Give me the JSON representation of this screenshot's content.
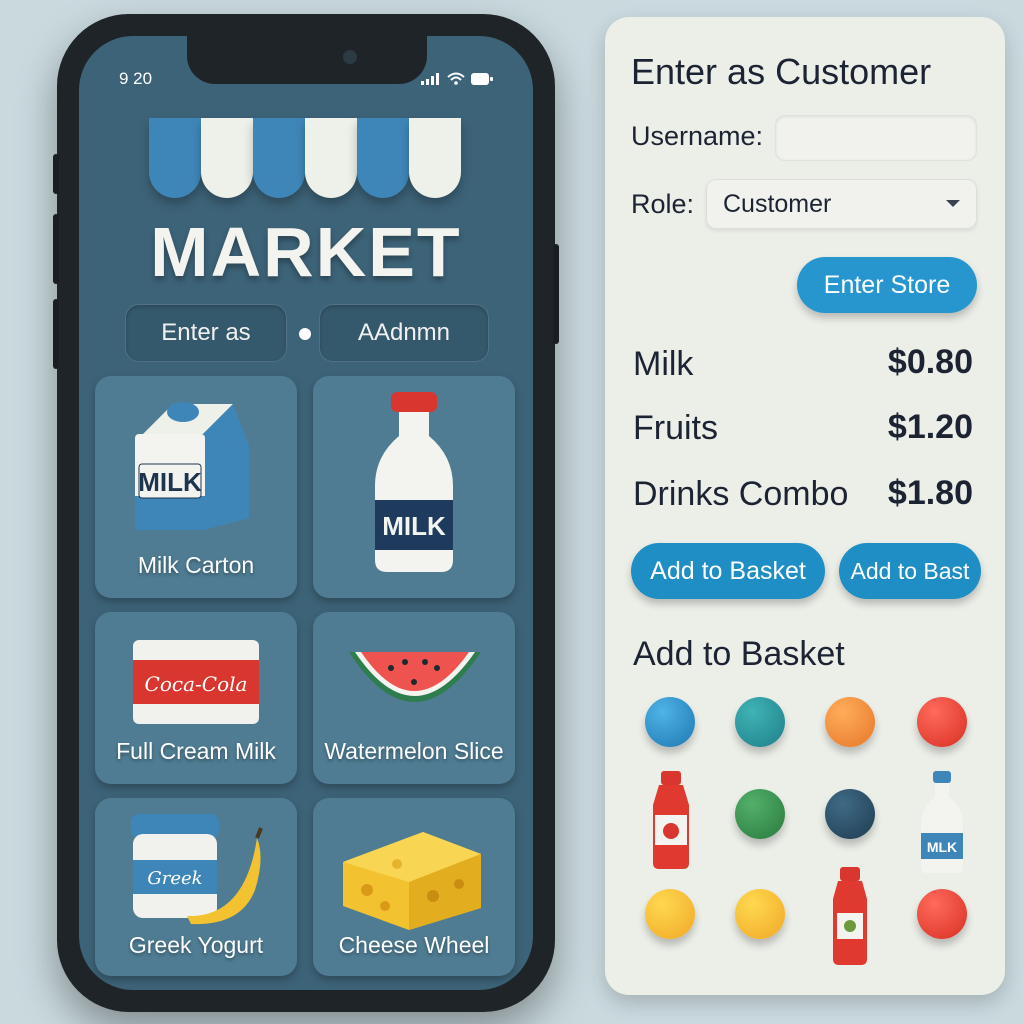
{
  "phone": {
    "time": "9 20",
    "brand": "MARKET",
    "segment": {
      "left": "Enter as",
      "right": "AAdnmn"
    },
    "tiles": [
      {
        "label": "Milk Carton",
        "icon": "milk-carton-icon",
        "text": "MILK"
      },
      {
        "label": "",
        "icon": "milk-bottle-icon",
        "text": "MILK"
      },
      {
        "label": "Full Cream Milk",
        "icon": "soda-box-icon",
        "text": "Coca-Cola"
      },
      {
        "label": "Watermelon Slice",
        "icon": "watermelon-icon"
      },
      {
        "label": "Greek Yogurt",
        "icon": "yogurt-banana-icon",
        "text": "Greek"
      },
      {
        "label": "Cheese Wheel",
        "icon": "cheese-icon"
      }
    ]
  },
  "panel": {
    "title": "Enter as Customer",
    "username_label": "Username:",
    "username_value": "",
    "role_label": "Role:",
    "role_value": "Customer",
    "enter_button": "Enter Store",
    "items": [
      {
        "name": "Milk",
        "price": "$0.80"
      },
      {
        "name": "Fruits",
        "price": "$1.20"
      },
      {
        "name": "Drinks Combo",
        "price": "$1.80"
      }
    ],
    "add_button_1": "Add to Basket",
    "add_button_2": "Add to Bast",
    "basket_heading": "Add to Basket",
    "milk_mini_text": "MLK"
  },
  "colors": {
    "accent": "#1f8ec4",
    "screen": "#3d6378",
    "panel": "#eceee8"
  }
}
